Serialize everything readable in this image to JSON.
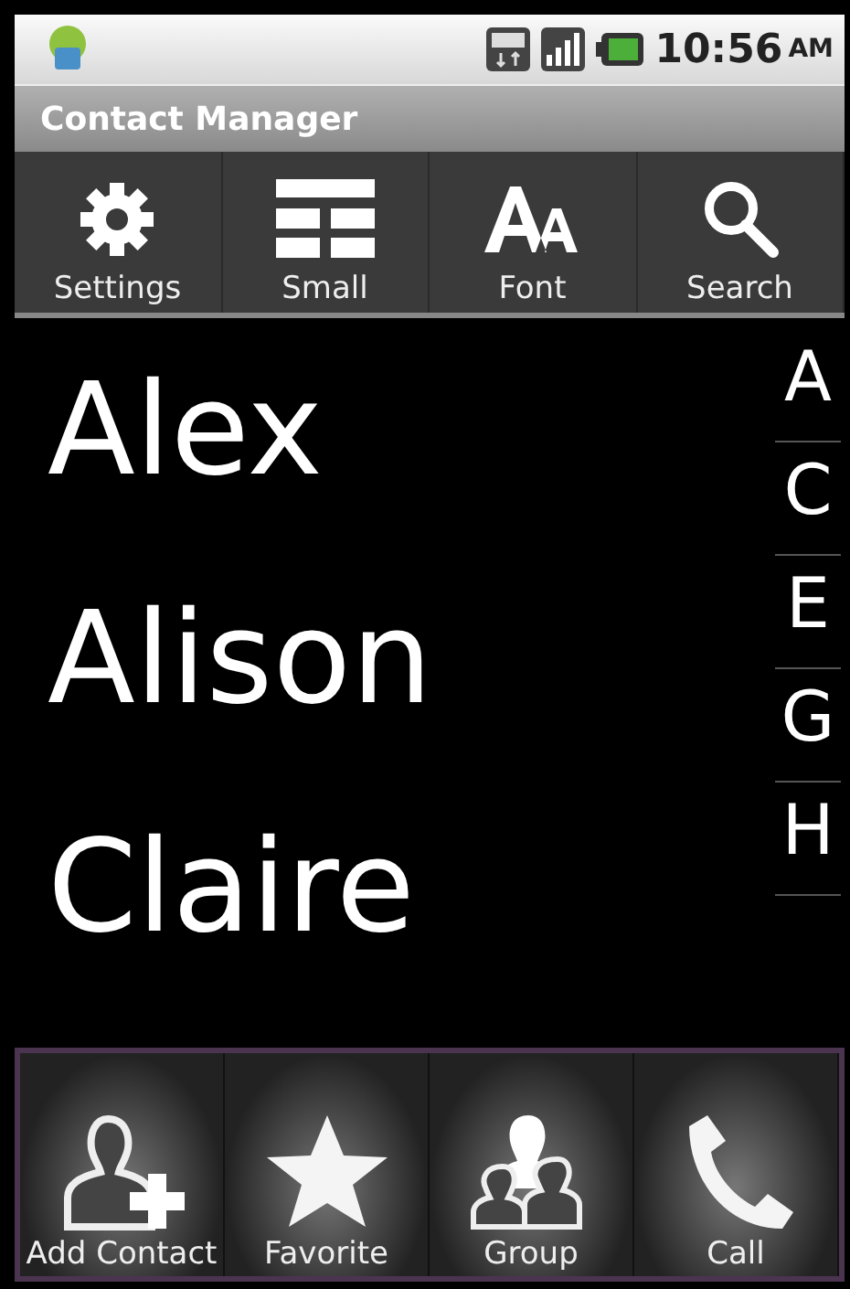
{
  "status_bar": {
    "time": "10:56",
    "meridiem": "AM"
  },
  "window": {
    "title": "Contact Manager"
  },
  "toolbar": [
    {
      "label": "Settings",
      "kind": "gear"
    },
    {
      "label": "Small",
      "kind": "layout"
    },
    {
      "label": "Font",
      "kind": "font"
    },
    {
      "label": "Search",
      "kind": "search"
    }
  ],
  "contacts": [
    "Alex",
    "Alison",
    "Claire"
  ],
  "index_letters": [
    "A",
    "C",
    "E",
    "G",
    "H"
  ],
  "bottom_bar": [
    {
      "label": "Add Contact",
      "kind": "add"
    },
    {
      "label": "Favorite",
      "kind": "star"
    },
    {
      "label": "Group",
      "kind": "group"
    },
    {
      "label": "Call",
      "kind": "call"
    }
  ]
}
